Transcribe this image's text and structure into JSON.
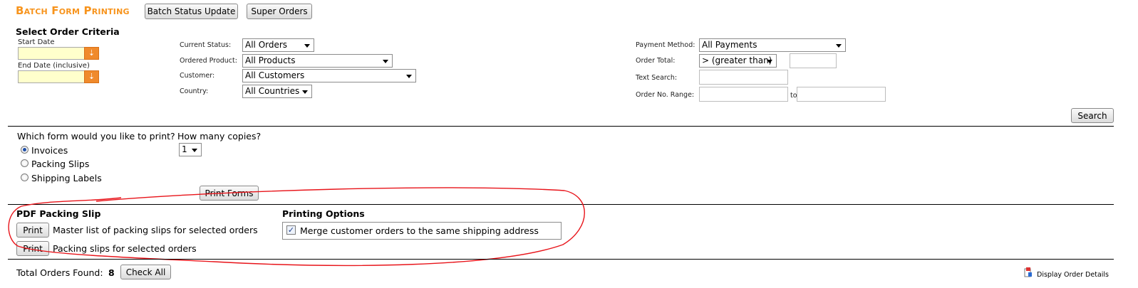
{
  "header": {
    "title": "Batch Form Printing",
    "batch_status_button": "Batch Status Update",
    "super_orders_button": "Super Orders"
  },
  "criteria": {
    "heading": "Select Order Criteria",
    "start_date_label": "Start Date",
    "end_date_label": "End Date (inclusive)",
    "current_status_label": "Current Status:",
    "current_status_value": "All Orders",
    "ordered_product_label": "Ordered Product:",
    "ordered_product_value": "All Products",
    "customer_label": "Customer:",
    "customer_value": "All Customers",
    "country_label": "Country:",
    "country_value": "All Countries",
    "payment_method_label": "Payment Method:",
    "payment_method_value": "All Payments",
    "order_total_label": "Order Total:",
    "order_total_operator": "> (greater than)",
    "text_search_label": "Text Search:",
    "order_range_label": "Order No. Range:",
    "range_to": "to",
    "search_button": "Search"
  },
  "forms": {
    "question": "Which form would you like to print?",
    "copies_label": "How many copies?",
    "copies_value": "1",
    "options": [
      "Invoices",
      "Packing Slips",
      "Shipping Labels"
    ],
    "selected": "Invoices",
    "print_forms_button": "Print Forms"
  },
  "pdf": {
    "heading": "PDF Packing Slip",
    "print_button": "Print",
    "master_list_text": "Master list of packing slips for selected orders",
    "slips_text": "Packing slips for selected orders"
  },
  "printing_options": {
    "heading": "Printing Options",
    "merge_text": "Merge customer orders to the same shipping address",
    "merge_checked": true
  },
  "footer": {
    "total_label": "Total Orders Found:",
    "total_count": "8",
    "check_all_button": "Check All",
    "display_details": "Display Order Details"
  },
  "colors": {
    "title_orange": "#f7941d",
    "annotation_red": "#e8141a",
    "date_field_yellow": "#ffffcc"
  }
}
